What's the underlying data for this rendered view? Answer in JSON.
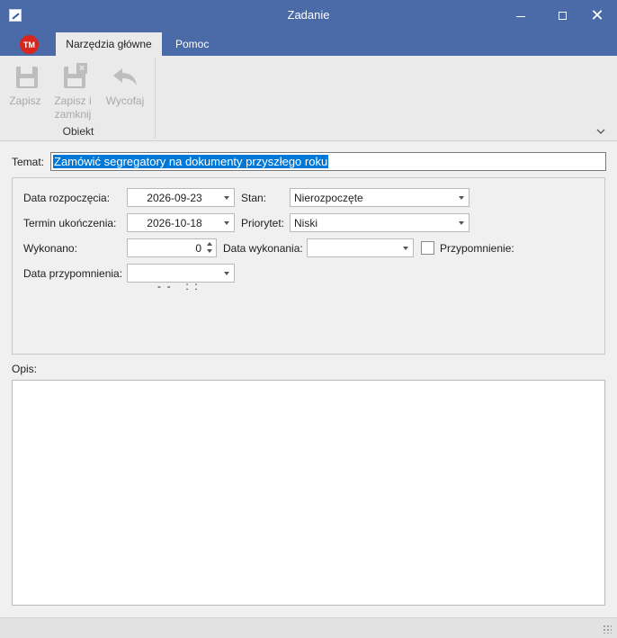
{
  "window": {
    "title": "Zadanie"
  },
  "tabs": {
    "badge": "TM",
    "active": "Narzędzia główne",
    "inactive": "Pomoc"
  },
  "ribbon": {
    "save_label": "Zapisz",
    "save_close_line1": "Zapisz i",
    "save_close_line2": "zamknij",
    "undo_label": "Wycofaj",
    "group_label": "Obiekt",
    "icons": [
      "save-icon",
      "save-close-icon",
      "undo-icon",
      "collapse-chevron-icon"
    ]
  },
  "form": {
    "temat_label": "Temat:",
    "temat_value": "Zamówić segregatory na dokumenty przyszłego roku",
    "start_label": "Data rozpoczęcia:",
    "start_value": "2026-09-23",
    "stan_label": "Stan:",
    "stan_value": "Nierozpoczęte",
    "due_label": "Termin ukończenia:",
    "due_value": "2026-10-18",
    "priority_label": "Priorytet:",
    "priority_value": "Niski",
    "done_label": "Wykonano:",
    "done_value": "0",
    "done_date_label": "Data wykonania:",
    "done_date_value": "",
    "reminder_label": "Przypomnienie:",
    "reminder_date_label": "Data przypomnienia:",
    "reminder_date_value": "-  -     :  :",
    "opis_label": "Opis:"
  },
  "colors": {
    "titlebar": "#4a6aa8",
    "selection": "#0078d7",
    "badge": "#d8251d"
  }
}
